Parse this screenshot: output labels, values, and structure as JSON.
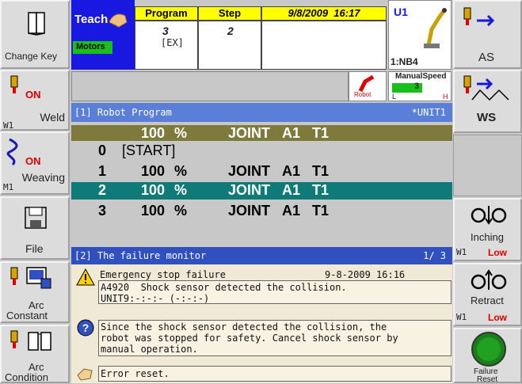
{
  "header": {
    "mode": "Teach",
    "motors": "Motors",
    "program_label": "Program",
    "program_value": "3",
    "program_sub": "[EX]",
    "step_label": "Step",
    "step_value": "2",
    "datetime": "9/8/2009  16:17",
    "unit": "U1",
    "nb": "1:NB4",
    "manual_speed_label": "ManualSpeed",
    "manual_speed_value": "3",
    "speed_low": "L",
    "speed_high": "H",
    "robot_icon_label": "Robot"
  },
  "left_buttons": [
    {
      "label": "Change Key"
    },
    {
      "label": "Weld",
      "status": "ON",
      "tag": "W1"
    },
    {
      "label": "Weaving",
      "status": "ON",
      "tag": "M1"
    },
    {
      "label": "File"
    },
    {
      "label1": "Arc",
      "label2": "Constant"
    },
    {
      "label1": "Arc",
      "label2": "Condition"
    }
  ],
  "right_buttons": [
    {
      "label": "AS"
    },
    {
      "label": "WS"
    },
    {
      "label": "Inching",
      "tag": "W1",
      "level": "Low"
    },
    {
      "label": "Retract",
      "tag": "W1",
      "level": "Low"
    },
    {
      "label1": "Failure",
      "label2": "Reset"
    }
  ],
  "program_panel": {
    "title": "[1] Robot Program",
    "unit": "*UNIT1",
    "current_line": {
      "speed": "100",
      "unit": "%",
      "mode": "JOINT",
      "a": "A1",
      "t": "T1"
    },
    "rows": [
      {
        "num": "0",
        "text": "[START]"
      },
      {
        "num": "1",
        "speed": "100",
        "unit": "%",
        "mode": "JOINT",
        "a": "A1",
        "t": "T1"
      },
      {
        "num": "2",
        "speed": "100",
        "unit": "%",
        "mode": "JOINT",
        "a": "A1",
        "t": "T1"
      },
      {
        "num": "3",
        "speed": "100",
        "unit": "%",
        "mode": "JOINT",
        "a": "A1",
        "t": "T1"
      }
    ]
  },
  "failure_panel": {
    "title": "[2] The failure monitor",
    "page": "1/ 3",
    "error_title": "Emergency stop failure",
    "error_time": "9-8-2009 16:16",
    "error_line1": "A4920  Shock sensor detected the collision.",
    "error_line2": "UNIT9:-:-:- (-:-:-)",
    "help_line1": "Since the shock sensor detected the collision, the",
    "help_line2": "robot was stopped for safety. Cancel shock sensor by",
    "help_line3": "manual operation.",
    "action_line": "Error reset."
  },
  "colors": {
    "teach_blue": "#1818e0",
    "panel_title_blue": "#5a7fd8",
    "current_row_olive": "#7e7a3c",
    "selected_row_teal": "#107a78",
    "red": "#e00000",
    "yellow": "#ffff00"
  }
}
